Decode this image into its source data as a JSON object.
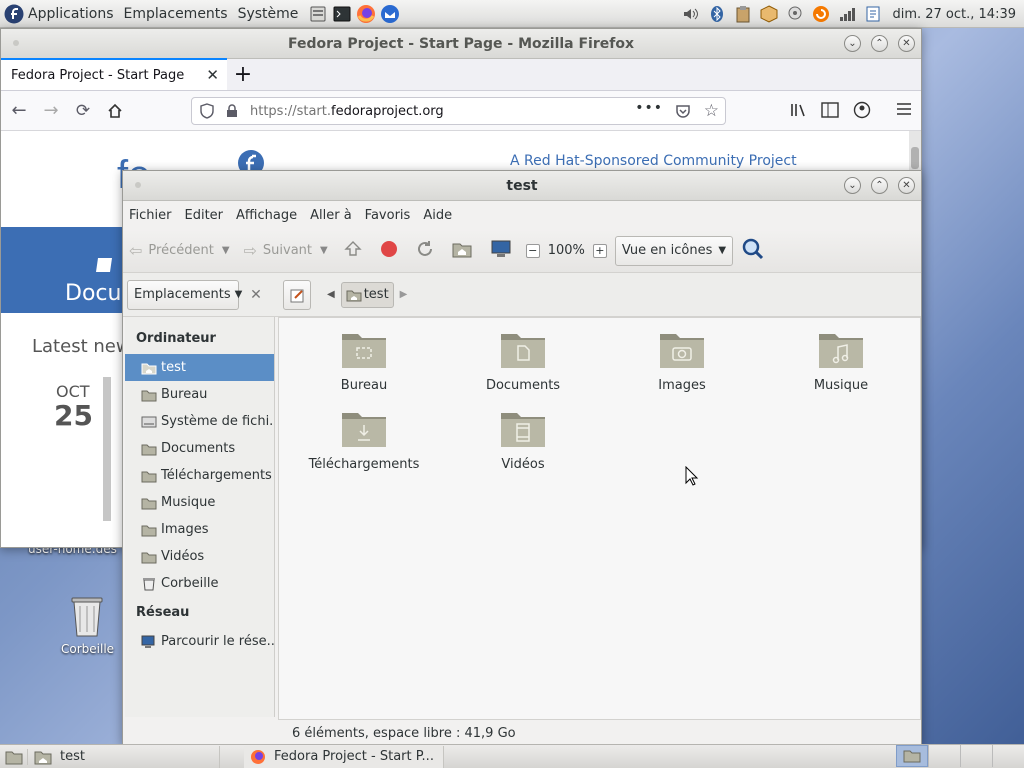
{
  "top_panel": {
    "menus": [
      "Applications",
      "Emplacements",
      "Système"
    ],
    "clock": "dim. 27 oct., 14:39"
  },
  "desktop": {
    "trash_label": "Corbeille",
    "home_label": "user-home.des"
  },
  "firefox": {
    "window_title": "Fedora Project - Start Page - Mozilla Firefox",
    "tab_title": "Fedora Project - Start Page",
    "url_prefix": "https://start.",
    "url_domain": "fedoraproject.org",
    "content": {
      "logo_text": "fe",
      "tagline": "A Red Hat-Sponsored Community Project",
      "banner_text": "Docu",
      "latest_text": "Latest new",
      "date_month": "OCT",
      "date_day": "25"
    }
  },
  "file_manager": {
    "window_title": "test",
    "menubar": [
      "Fichier",
      "Editer",
      "Affichage",
      "Aller à",
      "Favoris",
      "Aide"
    ],
    "toolbar": {
      "back_label": "Précédent",
      "forward_label": "Suivant",
      "zoom": "100%",
      "view_mode": "Vue en icônes"
    },
    "location": {
      "places_combo": "Emplacements",
      "crumb": "test"
    },
    "sidebar": {
      "computer_heading": "Ordinateur",
      "items": [
        {
          "label": "test",
          "icon": "home-folder-icon",
          "selected": true
        },
        {
          "label": "Bureau",
          "icon": "desktop-folder-icon",
          "selected": false
        },
        {
          "label": "Système de fichi...",
          "icon": "drive-icon",
          "selected": false
        },
        {
          "label": "Documents",
          "icon": "documents-folder-icon",
          "selected": false
        },
        {
          "label": "Téléchargements",
          "icon": "downloads-folder-icon",
          "selected": false
        },
        {
          "label": "Musique",
          "icon": "music-folder-icon",
          "selected": false
        },
        {
          "label": "Images",
          "icon": "pictures-folder-icon",
          "selected": false
        },
        {
          "label": "Vidéos",
          "icon": "videos-folder-icon",
          "selected": false
        },
        {
          "label": "Corbeille",
          "icon": "trash-icon",
          "selected": false
        }
      ],
      "network_heading": "Réseau",
      "network_items": [
        {
          "label": "Parcourir le rése...",
          "icon": "network-icon"
        }
      ]
    },
    "files": [
      {
        "label": "Bureau",
        "icon": "desktop-folder-icon"
      },
      {
        "label": "Documents",
        "icon": "documents-folder-icon"
      },
      {
        "label": "Images",
        "icon": "pictures-folder-icon"
      },
      {
        "label": "Musique",
        "icon": "music-folder-icon"
      },
      {
        "label": "Téléchargements",
        "icon": "downloads-folder-icon"
      },
      {
        "label": "Vidéos",
        "icon": "videos-folder-icon"
      }
    ],
    "status": "6 éléments, espace libre : 41,9 Go"
  },
  "taskbar": {
    "tasks": [
      "test",
      "Fedora Project - Start P..."
    ]
  },
  "colors": {
    "selection": "#5b8ec6",
    "fedora_blue": "#3c6eb4",
    "folder": "#9a9987"
  }
}
